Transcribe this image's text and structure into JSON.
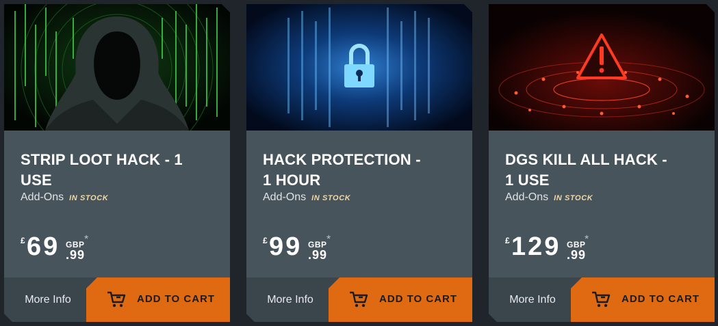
{
  "products": [
    {
      "title": "STRIP LOOT HACK - 1 USE",
      "category": "Add-Ons",
      "stock": "IN STOCK",
      "currency_symbol": "£",
      "price_whole": "69",
      "currency_code": "GBP",
      "price_cents": ".99",
      "asterisk": "*",
      "image": "hooded-hacker-image",
      "more_info_label": "More Info",
      "add_to_cart_label": "ADD TO CART"
    },
    {
      "title": "HACK PROTECTION - 1 HOUR",
      "category": "Add-Ons",
      "stock": "IN STOCK",
      "currency_symbol": "£",
      "price_whole": "99",
      "currency_code": "GBP",
      "price_cents": ".99",
      "asterisk": "*",
      "image": "padlock-security-image",
      "more_info_label": "More Info",
      "add_to_cart_label": "ADD TO CART"
    },
    {
      "title": "DGS KILL ALL HACK - 1 USE",
      "category": "Add-Ons",
      "stock": "IN STOCK",
      "currency_symbol": "£",
      "price_whole": "129",
      "currency_code": "GBP",
      "price_cents": ".99",
      "asterisk": "*",
      "image": "red-warning-network-image",
      "more_info_label": "More Info",
      "add_to_cart_label": "ADD TO CART"
    }
  ],
  "colors": {
    "page_background": "#1f252a",
    "card_background": "#48545c",
    "footer_background": "#3b454c",
    "accent_orange": "#e06a12",
    "stock_text": "#f0d9a8"
  },
  "icons": {
    "cart": "shopping-cart-icon"
  }
}
